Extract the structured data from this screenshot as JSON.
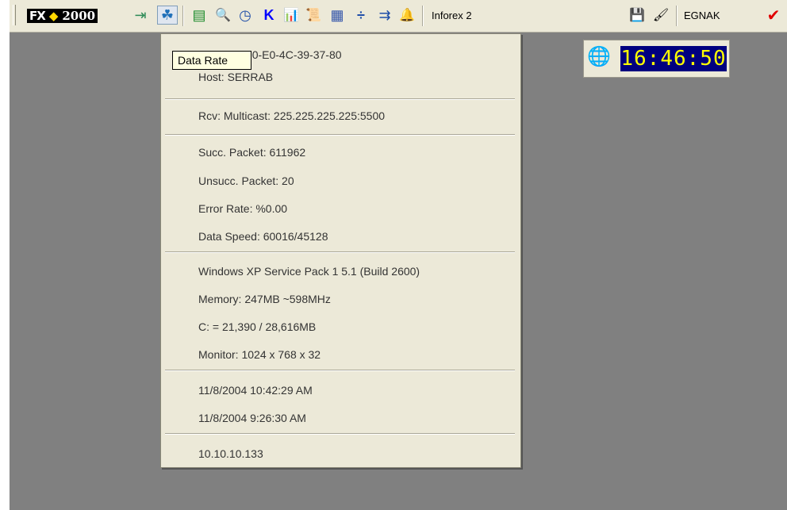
{
  "toolbar": {
    "logo": {
      "fx": "FX",
      "arrow": "◆",
      "year": "2000"
    },
    "icons": [
      {
        "name": "exit-icon",
        "glyph": "⇥",
        "color": "#2e8b57"
      },
      {
        "name": "data-rate-icon",
        "glyph": "☘",
        "color": "#1e6fb8"
      },
      {
        "name": "database-icon",
        "glyph": "▤",
        "color": "#1a8a2a"
      },
      {
        "name": "search-icon",
        "glyph": "🔍",
        "color": "#1f4ea8"
      },
      {
        "name": "clock-icon",
        "glyph": "◷",
        "color": "#1f4ea8"
      },
      {
        "name": "k-icon",
        "glyph": "K",
        "color": "#0000ff"
      },
      {
        "name": "chart-icon",
        "glyph": "📊",
        "color": "#0000aa"
      },
      {
        "name": "document-icon",
        "glyph": "📜",
        "color": "#3a6e1a"
      },
      {
        "name": "grid-icon",
        "glyph": "▦",
        "color": "#3355aa"
      },
      {
        "name": "divide-icon",
        "glyph": "÷",
        "color": "#1f4ea8"
      },
      {
        "name": "transfer-icon",
        "glyph": "⇉",
        "color": "#1f4ea8"
      },
      {
        "name": "bell-icon",
        "glyph": "🔔",
        "color": "#444444"
      }
    ],
    "app_label": "Inforex 2",
    "save_icon": {
      "name": "save-icon",
      "glyph": "💾"
    },
    "brush_icon": {
      "name": "brush-icon",
      "glyph": "🖌"
    },
    "user_label": "EGNAK",
    "check_icon": {
      "name": "check-icon",
      "glyph": "✔",
      "color": "#e00000"
    }
  },
  "clock": {
    "time": "16:46:50",
    "icon": "globe-icon"
  },
  "tooltip": {
    "text": "Data Rate"
  },
  "menu": {
    "items": [
      {
        "id": "card",
        "text": "Card No: 00-E0-4C-39-37-80"
      },
      {
        "id": "host",
        "text": "Host: SERRAB"
      },
      {
        "id": "rcv",
        "text": "Rcv: Multicast: 225.225.225.225:5500"
      },
      {
        "id": "succ",
        "text": "Succ. Packet: 611962"
      },
      {
        "id": "unsucc",
        "text": "Unsucc. Packet: 20"
      },
      {
        "id": "error",
        "text": "Error Rate:  %0.00"
      },
      {
        "id": "speed",
        "text": "Data Speed: 60016/45128"
      },
      {
        "id": "os",
        "text": "Windows XP Service Pack 1 5.1 (Build 2600)"
      },
      {
        "id": "memory",
        "text": "Memory: 247MB ~598MHz"
      },
      {
        "id": "disk",
        "text": "C: = 21,390 / 28,616MB"
      },
      {
        "id": "monitor",
        "text": "Monitor: 1024 x 768 x 32"
      },
      {
        "id": "date1",
        "text": "11/8/2004 10:42:29 AM"
      },
      {
        "id": "date2",
        "text": "11/8/2004 9:26:30 AM"
      },
      {
        "id": "ip",
        "text": "10.10.10.133"
      }
    ]
  }
}
